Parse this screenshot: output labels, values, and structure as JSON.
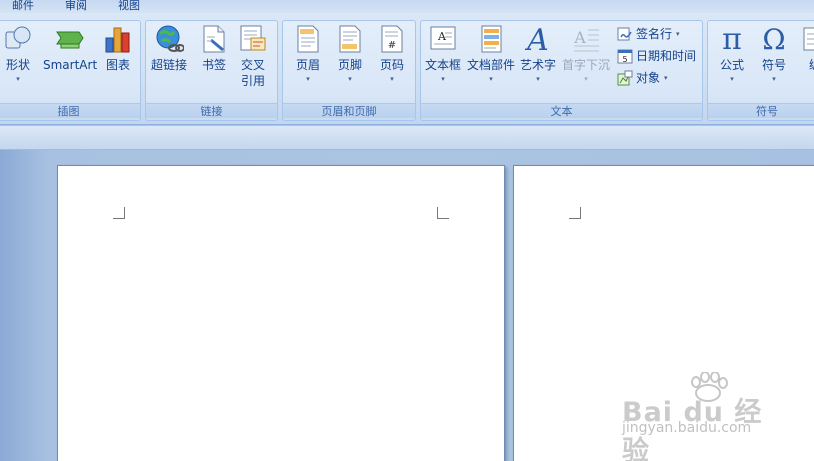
{
  "tabs": [
    {
      "label": "邮件"
    },
    {
      "label": "审阅"
    },
    {
      "label": "视图"
    }
  ],
  "groups": {
    "illustrations": {
      "label": "插图",
      "buttons": [
        {
          "label": "形状",
          "icon": "shapes-icon"
        },
        {
          "label": "SmartArt",
          "icon": "smartart-icon"
        },
        {
          "label": "图表",
          "icon": "chart-icon"
        }
      ]
    },
    "links": {
      "label": "链接",
      "buttons": [
        {
          "label": "超链接",
          "icon": "hyperlink-icon"
        },
        {
          "label": "书签",
          "icon": "bookmark-icon"
        },
        {
          "label": "交叉\n引用",
          "label_line1": "交叉",
          "label_line2": "引用",
          "icon": "cross-reference-icon"
        }
      ]
    },
    "header_footer": {
      "label": "页眉和页脚",
      "buttons": [
        {
          "label": "页眉",
          "icon": "header-icon"
        },
        {
          "label": "页脚",
          "icon": "footer-icon"
        },
        {
          "label": "页码",
          "icon": "page-number-icon"
        }
      ]
    },
    "text": {
      "label": "文本",
      "buttons": [
        {
          "label": "文本框",
          "icon": "textbox-icon"
        },
        {
          "label": "文档部件",
          "icon": "quick-parts-icon"
        },
        {
          "label": "艺术字",
          "icon": "wordart-icon"
        },
        {
          "label": "首字下沉",
          "icon": "drop-cap-icon",
          "disabled": true
        }
      ],
      "small_buttons": [
        {
          "label": "签名行",
          "icon": "signature-line-icon"
        },
        {
          "label": "日期和时间",
          "icon": "date-time-icon"
        },
        {
          "label": "对象",
          "icon": "object-icon"
        }
      ]
    },
    "symbols": {
      "label": "符号",
      "buttons": [
        {
          "label": "公式",
          "icon": "pi-equation-icon"
        },
        {
          "label": "符号",
          "icon": "omega-symbol-icon"
        },
        {
          "label": "编",
          "icon": "numbering-icon"
        }
      ]
    }
  },
  "dropdown_arrow": "▾",
  "watermark": {
    "logo_text": "Bai du 经验",
    "url": "jingyan.baidu.com"
  },
  "colors": {
    "ribbon_text": "#15428b",
    "workspace": "#abc4e2",
    "page": "#ffffff"
  }
}
